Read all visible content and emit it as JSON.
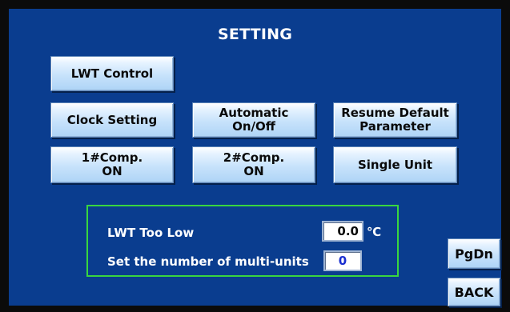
{
  "screen": {
    "title": "SETTING"
  },
  "buttons": {
    "lwt_control": "LWT Control",
    "clock_setting": "Clock Setting",
    "automatic_onoff": [
      "Automatic",
      "On/Off"
    ],
    "resume_default": [
      "Resume Default",
      "Parameter"
    ],
    "comp1": [
      "1#Comp.",
      "ON"
    ],
    "comp2": [
      "2#Comp.",
      "ON"
    ],
    "single_unit": "Single Unit",
    "pgdn": "PgDn",
    "back": "BACK"
  },
  "panel": {
    "lwt_too_low_label": "LWT Too Low",
    "lwt_too_low_value": "0.0",
    "lwt_unit": "℃",
    "multi_units_label": "Set the number of multi-units",
    "multi_units_value": "0"
  },
  "colors": {
    "screen_background": "#0a3d8f",
    "panel_border": "#39d63f",
    "multi_units_value_text": "#1a2fd0"
  }
}
